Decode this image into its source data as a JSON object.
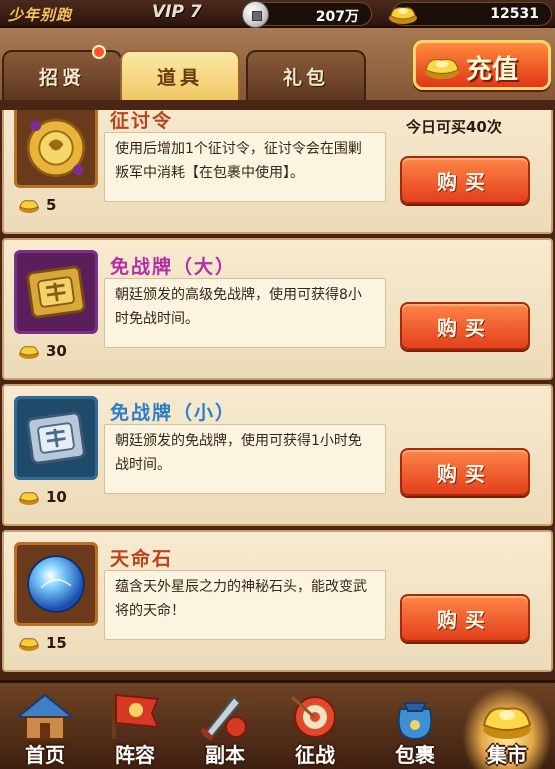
{
  "topbar": {
    "player_name": "少年别跑",
    "vip": "VIP 7",
    "coins": "207万",
    "gold": "12531"
  },
  "tabs": [
    {
      "label": "招贤",
      "active": false
    },
    {
      "label": "道具",
      "active": true
    },
    {
      "label": "礼包",
      "active": false
    }
  ],
  "recharge_label": "充值",
  "items": [
    {
      "name": "征讨令",
      "name_color": "brown",
      "icon": "scroll-icon",
      "description": "使用后增加1个征讨令，征讨令会在围剿叛军中消耗【在包裹中使用】。",
      "price": "5",
      "limit": "今日可买40次",
      "buy_label": "购买"
    },
    {
      "name": "免战牌（大）",
      "name_color": "purple",
      "icon": "large-truce-plate-icon",
      "description": "朝廷颁发的高级免战牌，使用可获得8小时免战时间。",
      "price": "30",
      "buy_label": "购买"
    },
    {
      "name": "免战牌（小）",
      "name_color": "blue",
      "icon": "small-truce-plate-icon",
      "description": "朝廷颁发的免战牌，使用可获得1小时免战时间。",
      "price": "10",
      "buy_label": "购买"
    },
    {
      "name": "天命石",
      "name_color": "brown",
      "icon": "destiny-stone-icon",
      "description": "蕴含天外星辰之力的神秘石头，能改变武将的天命！",
      "price": "15",
      "buy_label": "购买"
    }
  ],
  "bottom_nav": [
    {
      "label": "首页",
      "icon": "home-icon",
      "active": false
    },
    {
      "label": "阵容",
      "icon": "formation-icon",
      "active": false
    },
    {
      "label": "副本",
      "icon": "dungeon-icon",
      "active": false
    },
    {
      "label": "征战",
      "icon": "battle-icon",
      "active": false
    },
    {
      "label": "包裹",
      "icon": "bag-icon",
      "active": false
    },
    {
      "label": "集市",
      "icon": "market-icon",
      "active": true
    }
  ]
}
